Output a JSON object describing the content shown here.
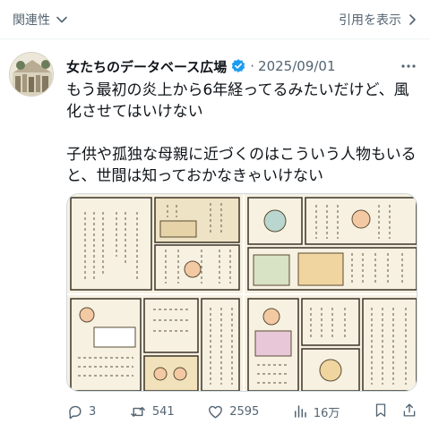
{
  "topbar": {
    "sort_label": "関連性",
    "quotes_label": "引用を表示"
  },
  "tweet": {
    "author_name": "女たちのデータベース広場",
    "separator": "·",
    "date": "2025/09/01",
    "text_paragraph_1": "もう最初の炎上から6年経ってるみたいだけど、風化させてはいけない",
    "text_paragraph_2": "子供や孤独な母親に近づくのはこういう人物もいると、世間は知っておかなきゃいけない"
  },
  "media": {
    "image_count": 4
  },
  "actions": {
    "replies": "3",
    "reposts": "541",
    "likes": "2595",
    "views": "16万"
  },
  "colors": {
    "text_primary": "#0f1419",
    "text_secondary": "#536471",
    "verified_blue": "#1d9bf0",
    "border": "#cfd9de"
  }
}
